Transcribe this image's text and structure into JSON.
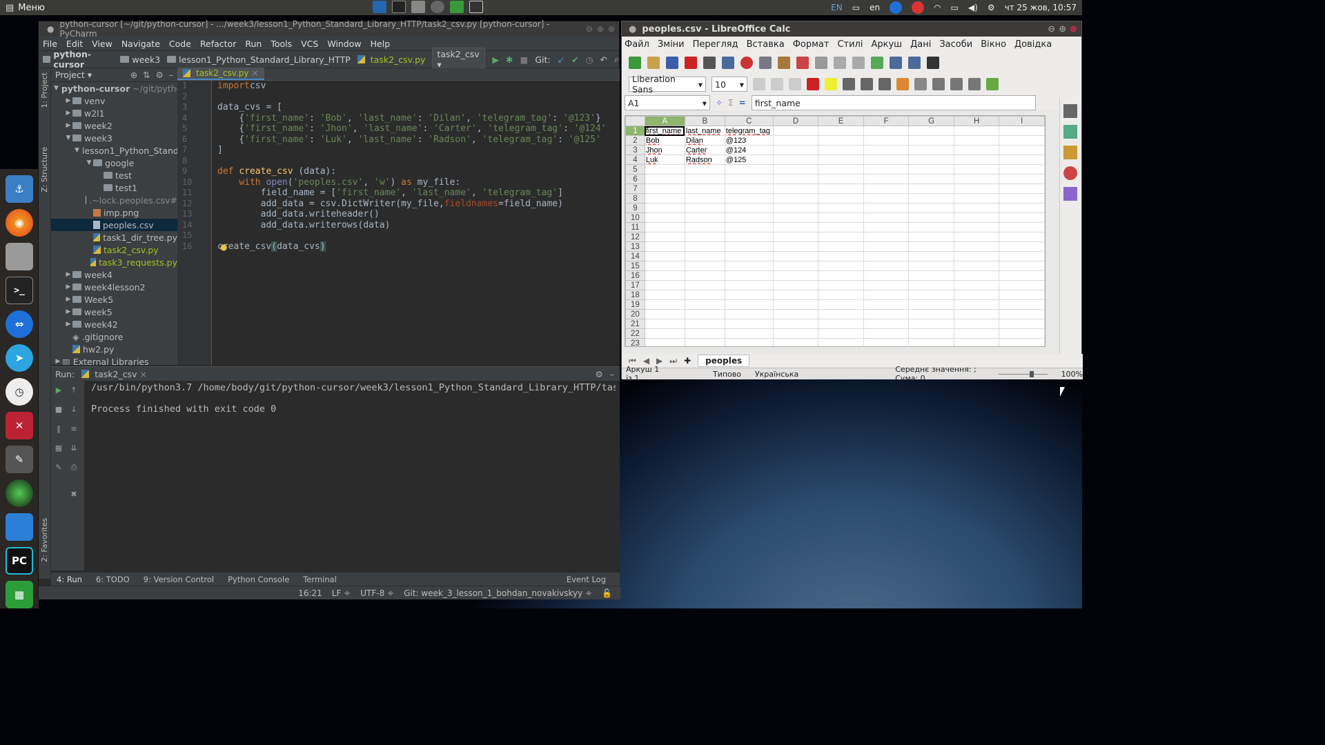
{
  "top_panel": {
    "menu_label": "Меню",
    "tray": {
      "lang1": "EN",
      "lang2": "en",
      "datetime": "чт 25 жов, 10:57"
    }
  },
  "pycharm": {
    "title": "python-cursor [~/git/python-cursor] - .../week3/lesson1_Python_Standard_Library_HTTP/task2_csv.py [python-cursor] - PyCharm",
    "menu": [
      "File",
      "Edit",
      "View",
      "Navigate",
      "Code",
      "Refactor",
      "Run",
      "Tools",
      "VCS",
      "Window",
      "Help"
    ],
    "breadcrumbs": [
      "python-cursor",
      "week3",
      "lesson1_Python_Standard_Library_HTTP",
      "task2_csv.py"
    ],
    "run_config": "task2_csv",
    "git_label": "Git:",
    "left_strip": {
      "project": "1: Project",
      "structure": "Z: Structure",
      "favorites": "2: Favorites"
    },
    "project_header": "Project",
    "tree": [
      {
        "label": "python-cursor",
        "extra": "~/git/pytho",
        "type": "folder",
        "indent": 0,
        "arrow": "▼"
      },
      {
        "label": "venv",
        "type": "folder",
        "indent": 1,
        "arrow": "▶"
      },
      {
        "label": "w2l1",
        "type": "folder",
        "indent": 1,
        "arrow": "▶"
      },
      {
        "label": "week2",
        "type": "folder",
        "indent": 1,
        "arrow": "▶"
      },
      {
        "label": "week3",
        "type": "folder",
        "indent": 1,
        "arrow": "▼"
      },
      {
        "label": "lesson1_Python_Stand",
        "type": "folder",
        "indent": 2,
        "arrow": "▼"
      },
      {
        "label": "google",
        "type": "folder",
        "indent": 3,
        "arrow": "▼"
      },
      {
        "label": "test",
        "type": "folder",
        "indent": 4,
        "arrow": ""
      },
      {
        "label": "test1",
        "type": "folder",
        "indent": 4,
        "arrow": ""
      },
      {
        "label": ".~lock.peoples.csv#",
        "type": "lock",
        "indent": 3,
        "arrow": ""
      },
      {
        "label": "imp.png",
        "type": "png",
        "indent": 3,
        "arrow": ""
      },
      {
        "label": "peoples.csv",
        "type": "csv",
        "indent": 3,
        "arrow": "",
        "selected": true
      },
      {
        "label": "task1_dir_tree.py",
        "type": "py",
        "indent": 3,
        "arrow": ""
      },
      {
        "label": "task2_csv.py",
        "type": "py",
        "indent": 3,
        "arrow": "",
        "color": "#a8c023"
      },
      {
        "label": "task3_requests.py",
        "type": "py",
        "indent": 3,
        "arrow": "",
        "color": "#a8c023"
      },
      {
        "label": "week4",
        "type": "folder",
        "indent": 1,
        "arrow": "▶"
      },
      {
        "label": "week4lesson2",
        "type": "folder",
        "indent": 1,
        "arrow": "▶"
      },
      {
        "label": "Week5",
        "type": "folder",
        "indent": 1,
        "arrow": "▶"
      },
      {
        "label": "week5",
        "type": "folder",
        "indent": 1,
        "arrow": "▶"
      },
      {
        "label": "week42",
        "type": "folder",
        "indent": 1,
        "arrow": "▶"
      },
      {
        "label": ".gitignore",
        "type": "git",
        "indent": 1,
        "arrow": ""
      },
      {
        "label": "hw2.py",
        "type": "py",
        "indent": 1,
        "arrow": ""
      },
      {
        "label": "External Libraries",
        "type": "lib",
        "indent": 0,
        "arrow": "▶"
      }
    ],
    "editor_tab": "task2_csv.py",
    "code_lines": [
      [
        [
          "kw",
          "import"
        ],
        [
          "",
          "csv"
        ]
      ],
      [],
      [
        [
          "",
          "data_cvs = ["
        ]
      ],
      [
        [
          "",
          "    {"
        ],
        [
          "st",
          "'first_name'"
        ],
        [
          "",
          ": "
        ],
        [
          "st",
          "'Bob'"
        ],
        [
          "",
          ", "
        ],
        [
          "st",
          "'last_name'"
        ],
        [
          "",
          ": "
        ],
        [
          "st",
          "'Dilan'"
        ],
        [
          "",
          ", "
        ],
        [
          "st",
          "'telegram_tag'"
        ],
        [
          "",
          ": "
        ],
        [
          "st",
          "'@123'"
        ],
        [
          "",
          "}"
        ]
      ],
      [
        [
          "",
          "    {"
        ],
        [
          "st",
          "'first_name'"
        ],
        [
          "",
          ": "
        ],
        [
          "st",
          "'Jhon'"
        ],
        [
          "",
          ", "
        ],
        [
          "st",
          "'last_name'"
        ],
        [
          "",
          ": "
        ],
        [
          "st",
          "'Carter'"
        ],
        [
          "",
          ", "
        ],
        [
          "st",
          "'telegram_tag'"
        ],
        [
          "",
          ": "
        ],
        [
          "st",
          "'@124'"
        ]
      ],
      [
        [
          "",
          "    {"
        ],
        [
          "st",
          "'first_name'"
        ],
        [
          "",
          ": "
        ],
        [
          "st",
          "'Luk'"
        ],
        [
          "",
          ", "
        ],
        [
          "st",
          "'last_name'"
        ],
        [
          "",
          ": "
        ],
        [
          "st",
          "'Radson'"
        ],
        [
          "",
          ", "
        ],
        [
          "st",
          "'telegram_tag'"
        ],
        [
          "",
          ": "
        ],
        [
          "st",
          "'@125'"
        ]
      ],
      [
        [
          "",
          "]"
        ]
      ],
      [],
      [
        [
          "kw",
          "def "
        ],
        [
          "fn",
          "create_csv"
        ],
        [
          "",
          " (data):"
        ]
      ],
      [
        [
          "",
          "    "
        ],
        [
          "kw",
          "with "
        ],
        [
          "bi",
          "open"
        ],
        [
          "",
          "("
        ],
        [
          "st",
          "'peoples.csv'"
        ],
        [
          "",
          ", "
        ],
        [
          "st",
          "'w'"
        ],
        [
          "",
          ") "
        ],
        [
          "kw",
          "as"
        ],
        [
          "",
          " my_file:"
        ]
      ],
      [
        [
          "",
          "        field_name = ["
        ],
        [
          "st",
          "'first_name'"
        ],
        [
          "",
          ", "
        ],
        [
          "st",
          "'last_name'"
        ],
        [
          "",
          ", "
        ],
        [
          "st",
          "'telegram_tag'"
        ],
        [
          "",
          "]"
        ]
      ],
      [
        [
          "",
          "        add_data = csv.DictWriter(my_file,"
        ],
        [
          "pa",
          "fieldnames"
        ],
        [
          "",
          "=field_name)"
        ]
      ],
      [
        [
          "",
          "        add_data.writeheader()"
        ]
      ],
      [
        [
          "",
          "        add_data.writerows(data)"
        ]
      ],
      [],
      [
        [
          "",
          "create_csv"
        ],
        [
          "hl",
          "("
        ],
        [
          "",
          "data_cvs"
        ],
        [
          "hl",
          ")"
        ]
      ]
    ],
    "line_numbers": [
      "1",
      "2",
      "3",
      "4",
      "5",
      "6",
      "7",
      "8",
      "9",
      "10",
      "11",
      "12",
      "13",
      "14",
      "15",
      "16"
    ],
    "run_label": "Run:",
    "run_tab": "task2_csv",
    "run_output": [
      "/usr/bin/python3.7 /home/body/git/python-cursor/week3/lesson1_Python_Standard_Library_HTTP/tas",
      "",
      "Process finished with exit code 0"
    ],
    "bottom_tabs": [
      "4: Run",
      "6: TODO",
      "9: Version Control",
      "Python Console",
      "Terminal"
    ],
    "event_log": "Event Log",
    "status": {
      "position": "16:21",
      "line_sep": "LF ÷",
      "encoding": "UTF-8 ÷",
      "git": "Git: week_3_lesson_1_bohdan_novakivskyy ÷"
    }
  },
  "calc": {
    "title": "peoples.csv - LibreOffice Calc",
    "menu": [
      "Файл",
      "Зміни",
      "Перегляд",
      "Вставка",
      "Формат",
      "Стилі",
      "Аркуш",
      "Дані",
      "Засоби",
      "Вікно",
      "Довідка"
    ],
    "font_name": "Liberation Sans",
    "font_size": "10",
    "cell_ref": "A1",
    "formula": "first_name",
    "columns": [
      "A",
      "B",
      "C",
      "D",
      "E",
      "F",
      "G",
      "H",
      "I"
    ],
    "rows": [
      [
        "first_name",
        "last_name",
        "telegram_tag"
      ],
      [
        "Bob",
        "Dilan",
        "@123"
      ],
      [
        "Jhon",
        "Carter",
        "@124"
      ],
      [
        "Luk",
        "Radson",
        "@125"
      ]
    ],
    "row_count": 23,
    "sheet_tab": "peoples",
    "status": {
      "sheet": "Аркуш 1 із 1",
      "style": "Типово",
      "lang": "Українська",
      "summary": "Середнє значення: ; Сума: 0",
      "zoom": "100%"
    }
  }
}
